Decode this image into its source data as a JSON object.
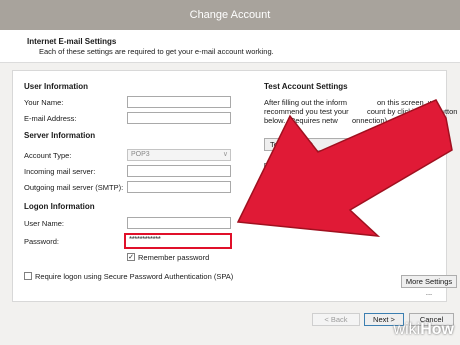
{
  "window": {
    "title": "Change Account"
  },
  "header": {
    "title": "Internet E-mail Settings",
    "subtitle": "Each of these settings are required to get your e-mail account working."
  },
  "user_info": {
    "heading": "User Information",
    "name_label": "Your Name:",
    "email_label": "E-mail Address:"
  },
  "server_info": {
    "heading": "Server Information",
    "account_type_label": "Account Type:",
    "account_type_value": "POP3",
    "incoming_label": "Incoming mail server:",
    "outgoing_label": "Outgoing mail server (SMTP):"
  },
  "logon_info": {
    "heading": "Logon Information",
    "username_label": "User Name:",
    "password_label": "Password:",
    "password_value": "************",
    "remember_label": "Remember password",
    "remember_checked": true,
    "spa_label": "Require logon using Secure Password Authentication (SPA)"
  },
  "test_settings": {
    "heading": "Test Account Settings",
    "desc_line1": "After filling out the inform",
    "desc_line1b": "on this screen, we",
    "desc_line2": "recommend you test your",
    "desc_line2b": "count by clicking the button",
    "desc_line3": "below. (Requires netw",
    "desc_line3b": "onnection)",
    "test_button": "Test Account",
    "test_button_tail": "ings ...",
    "checkbox_label": "Te"
  },
  "buttons": {
    "more_settings": "More Settings ...",
    "back": "< Back",
    "next": "Next >",
    "cancel": "Cancel"
  },
  "watermark": {
    "prefix": "wiki",
    "suffix": "How"
  },
  "colors": {
    "arrow": "#e01a36",
    "highlight": "#e0102a"
  }
}
